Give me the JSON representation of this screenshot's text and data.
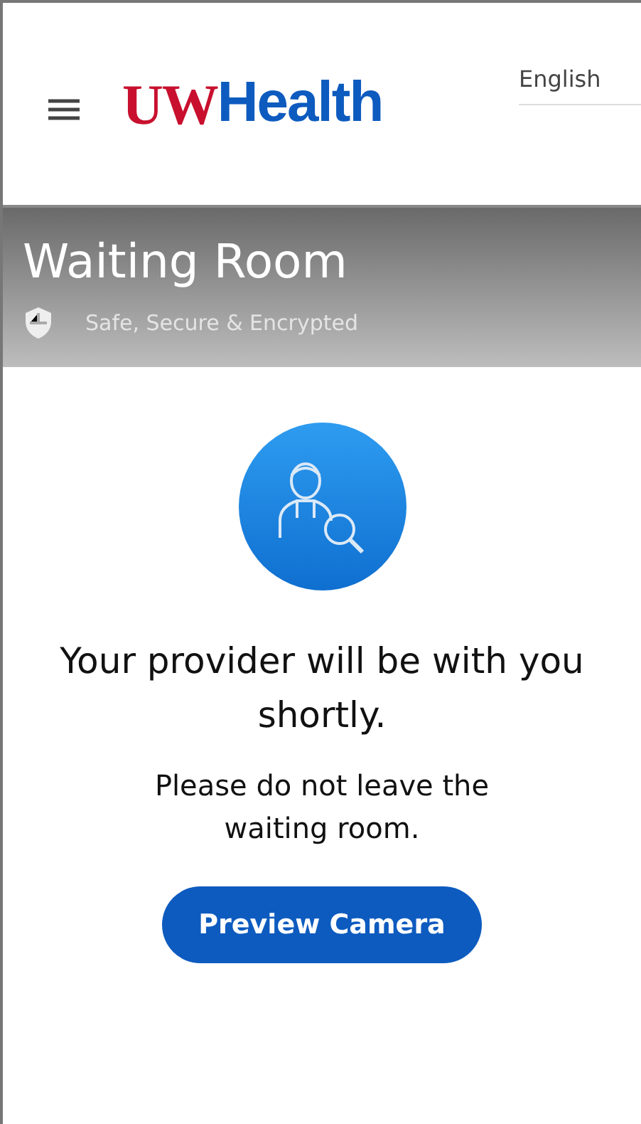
{
  "header": {
    "logo": [
      "UW",
      "Health"
    ],
    "language": "English"
  },
  "banner": {
    "title": "Waiting Room",
    "subtitle": "Safe, Secure & Encrypted"
  },
  "message": {
    "heading": "Your provider will be with you shortly.",
    "note": "Please do not leave the waiting room."
  },
  "buttons": [
    "Preview Camera"
  ]
}
